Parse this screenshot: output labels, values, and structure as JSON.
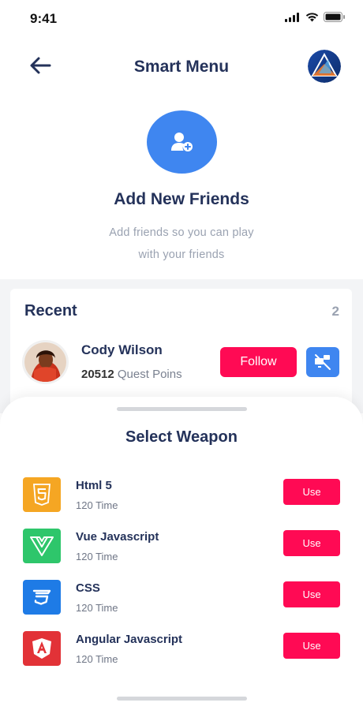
{
  "status_bar": {
    "time": "9:41"
  },
  "header": {
    "title": "Smart Menu"
  },
  "hero": {
    "title": "Add New Friends",
    "subtitle_line1": "Add friends so you can play",
    "subtitle_line2": "with your friends"
  },
  "recent": {
    "title": "Recent",
    "count": "2",
    "friend": {
      "name": "Cody Wilson",
      "points": "20512",
      "points_label": "Quest Poins",
      "follow_label": "Follow"
    }
  },
  "sheet": {
    "title": "Select Weapon",
    "weapons": [
      {
        "name": "Html 5",
        "meta": "120 Time",
        "button": "Use",
        "icon": "html5-icon",
        "color": "#f5a623"
      },
      {
        "name": "Vue Javascript",
        "meta": "120 Time",
        "button": "Use",
        "icon": "vue-icon",
        "color": "#2ec66b"
      },
      {
        "name": "CSS",
        "meta": "120 Time",
        "button": "Use",
        "icon": "css3-icon",
        "color": "#1e7be6"
      },
      {
        "name": "Angular Javascript",
        "meta": "120 Time",
        "button": "Use",
        "icon": "angular-icon",
        "color": "#e23237"
      }
    ]
  },
  "colors": {
    "accent_red": "#ff0a54",
    "accent_blue": "#3f86f0",
    "title_navy": "#24325a",
    "muted_gray": "#9aa2b1"
  }
}
